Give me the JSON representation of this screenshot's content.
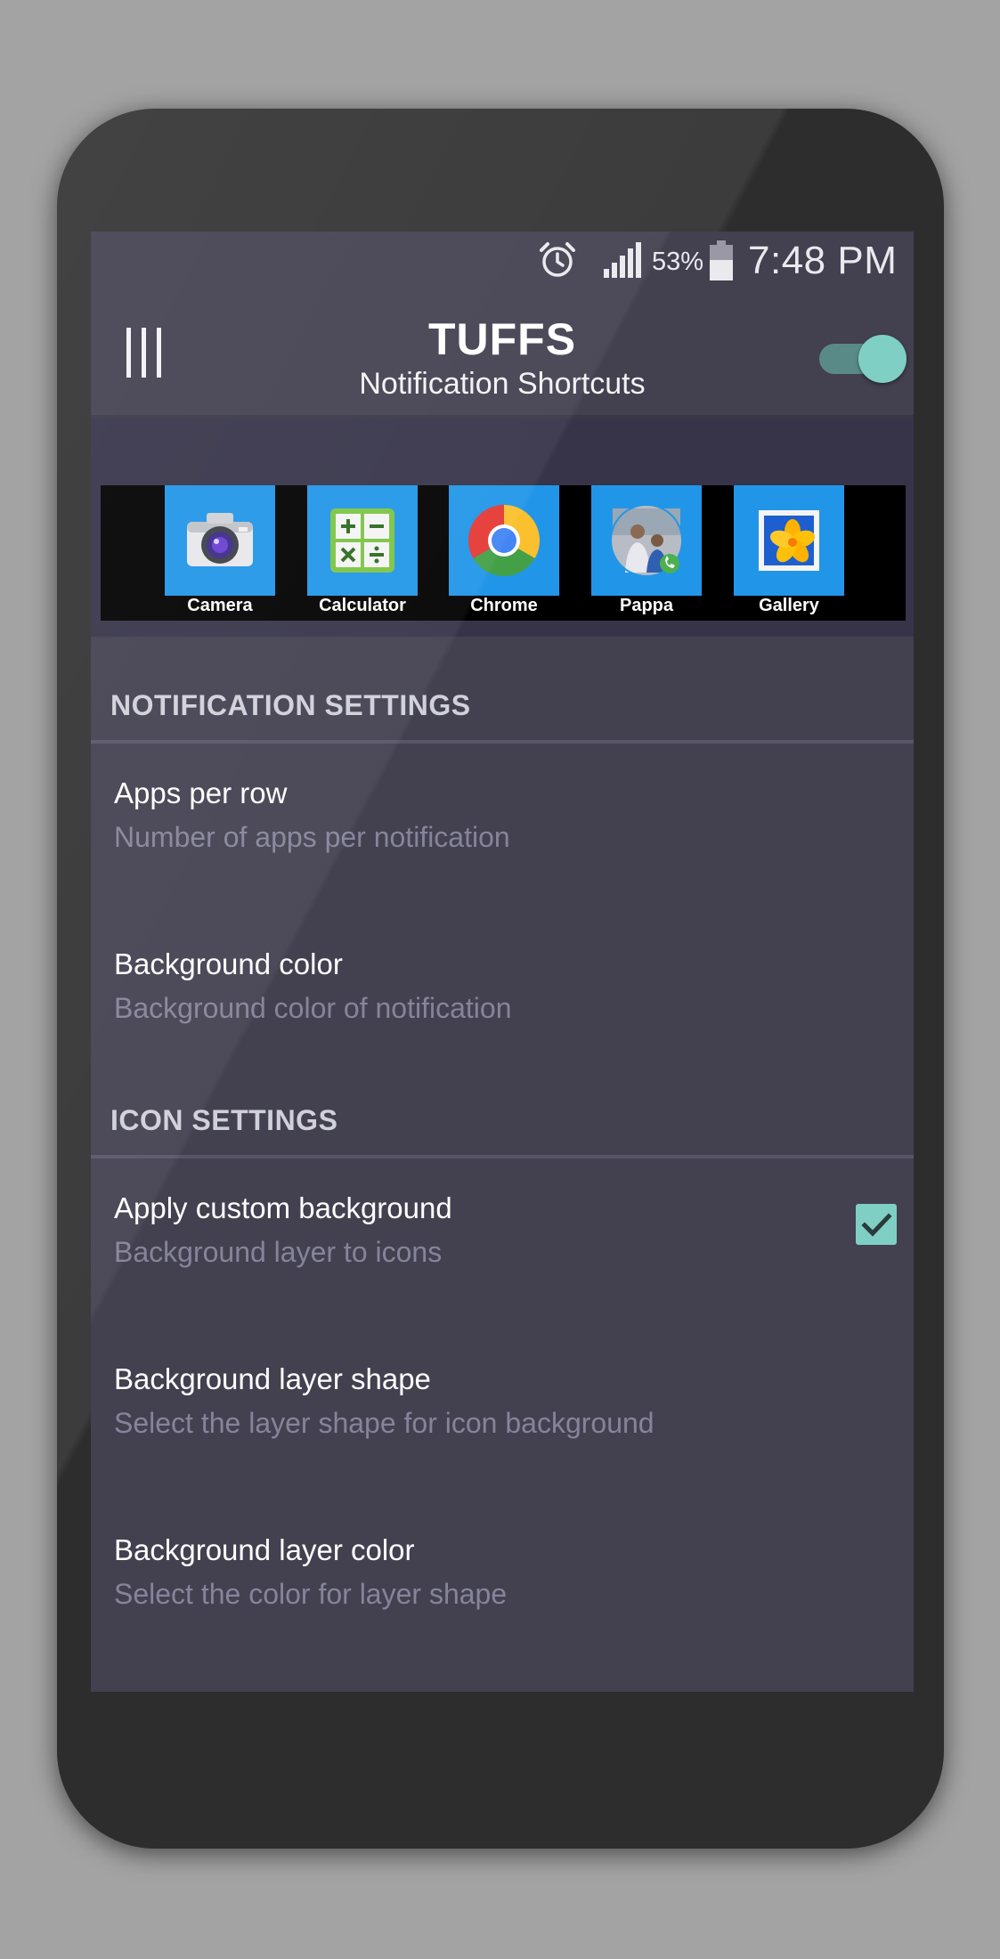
{
  "status_bar": {
    "battery_percent": "53%",
    "time": "7:48 PM",
    "icons": [
      "alarm-icon",
      "signal-icon",
      "battery-icon"
    ]
  },
  "app_bar": {
    "title": "TUFFS",
    "subtitle": "Notification Shortcuts",
    "toggle_on": true
  },
  "shortcuts": [
    {
      "label": "Camera",
      "icon": "camera-icon"
    },
    {
      "label": "Calculator",
      "icon": "calculator-icon"
    },
    {
      "label": "Chrome",
      "icon": "chrome-icon"
    },
    {
      "label": "Pappa",
      "icon": "contact-photo-icon"
    },
    {
      "label": "Gallery",
      "icon": "gallery-icon"
    }
  ],
  "notification_settings": {
    "header": "NOTIFICATION SETTINGS",
    "items": [
      {
        "title": "Apps per row",
        "summary": "Number of apps per notification"
      },
      {
        "title": "Background color",
        "summary": "Background color of notification"
      }
    ]
  },
  "icon_settings": {
    "header": "ICON SETTINGS",
    "items": [
      {
        "title": "Apply custom background",
        "summary": "Background layer to icons",
        "checked": true
      },
      {
        "title": "Background layer shape",
        "summary": "Select the layer shape for icon background"
      },
      {
        "title": "Background layer color",
        "summary": "Select the color for layer shape"
      }
    ]
  },
  "colors": {
    "accent": "#7fcfc4",
    "screen_background": "#434050",
    "tile_background": "#2196e8"
  }
}
